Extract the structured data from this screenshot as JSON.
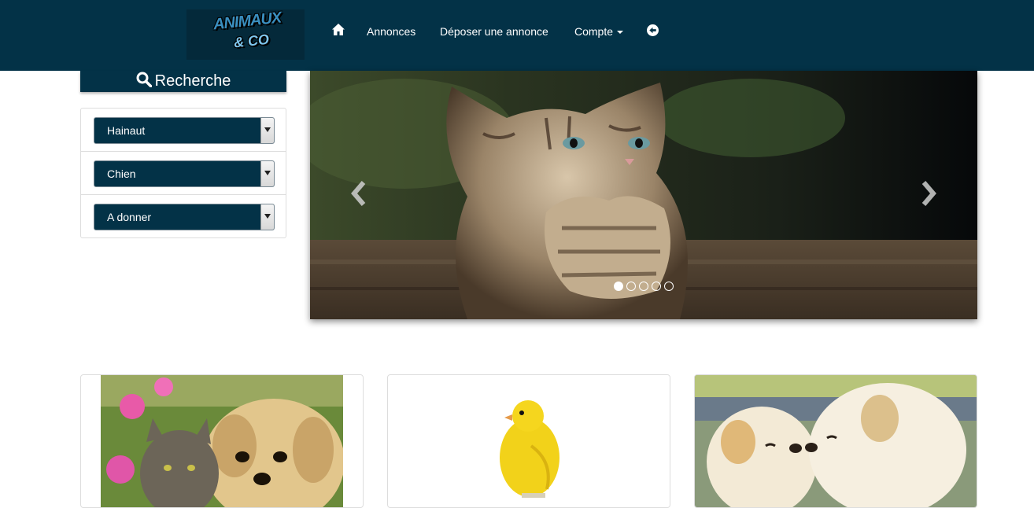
{
  "brand": {
    "line1": "ANIMAUX",
    "line2": "& CO"
  },
  "nav": {
    "annonces": "Annonces",
    "deposer": "Déposer une annonce",
    "compte": "Compte"
  },
  "sidebar": {
    "title": "Recherche",
    "filters": [
      {
        "value": "Hainaut"
      },
      {
        "value": "Chien"
      },
      {
        "value": "A donner"
      }
    ]
  },
  "carousel": {
    "slide_count": 5,
    "active_index": 0
  },
  "colors": {
    "primary": "#033247",
    "border": "#dddddd"
  },
  "icons": {
    "home": "home-icon",
    "logout": "circle-arrow-left-icon",
    "search": "search-icon",
    "prev": "chevron-left-icon",
    "next": "chevron-right-icon"
  }
}
